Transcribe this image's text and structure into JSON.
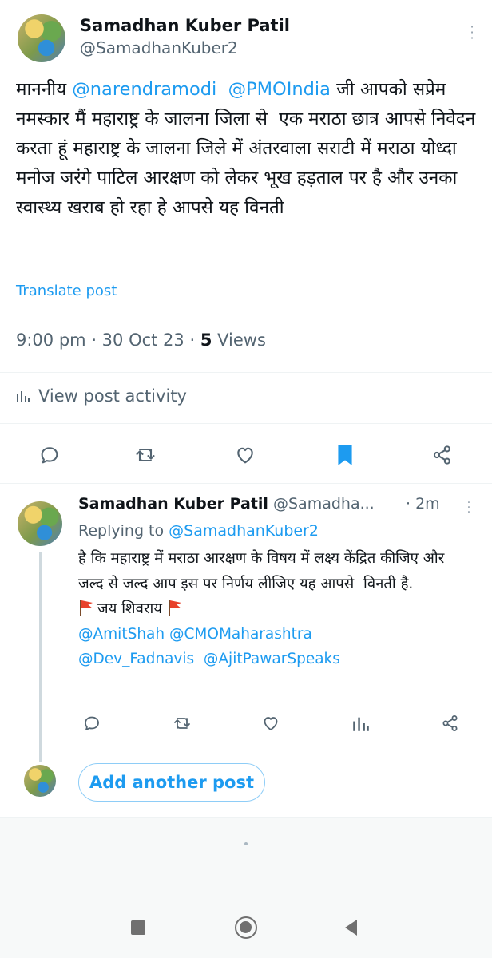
{
  "main_post": {
    "author_name": "Samadhan Kuber Patil",
    "author_handle": "@SamadhanKuber2",
    "text_parts": [
      "माननीय ",
      "@narendramodi",
      "  ",
      "@PMOIndia",
      " जी आपको सप्रेम नमस्कार मैं महाराष्ट्र के जालना जिला से  एक मराठा छात्र आपसे निवेदन करता हूं महाराष्ट्र के जालना जिले में अंतरवाला सराटी में मराठा योध्दा मनोज जरंगे पाटिल आरक्षण को लेकर भूख हड़ताल पर है और उनका स्वास्थ्य खराब हो रहा हे आपसे यह विनती"
    ],
    "translate_label": "Translate post",
    "time": "9:00 pm",
    "date": "30 Oct 23",
    "views_count": "5",
    "views_label": "Views",
    "activity_label": "View post activity"
  },
  "reply_post": {
    "author_name": "Samadhan Kuber Patil",
    "author_handle": "@Samadha...",
    "time": "2m",
    "replying_prefix": "Replying to ",
    "replying_to": "@SamadhanKuber2",
    "text": "है कि महाराष्ट्र में मराठा आरक्षण के विषय में लक्ष्य केंद्रित कीजिए और जल्द से जल्द आप इस पर निर्णय लीजिए यह आपसे  विनती है.",
    "slogan": " जय शिवराय ",
    "mentions_line1": [
      "@AmitShah",
      "@CMOMaharashtra"
    ],
    "mentions_line2": [
      "@Dev_Fadnavis",
      "@AjitPawarSpeaks"
    ]
  },
  "compose": {
    "add_button": "Add another post"
  },
  "colors": {
    "accent": "#1d9bf0",
    "secondary_text": "#536471",
    "bookmark_active": "#1d9bf0"
  },
  "icons": {
    "main_actions": [
      "reply-icon",
      "repost-icon",
      "like-icon",
      "bookmark-icon",
      "share-icon"
    ],
    "reply_actions": [
      "reply-icon",
      "repost-icon",
      "like-icon",
      "analytics-icon",
      "share-icon"
    ]
  }
}
